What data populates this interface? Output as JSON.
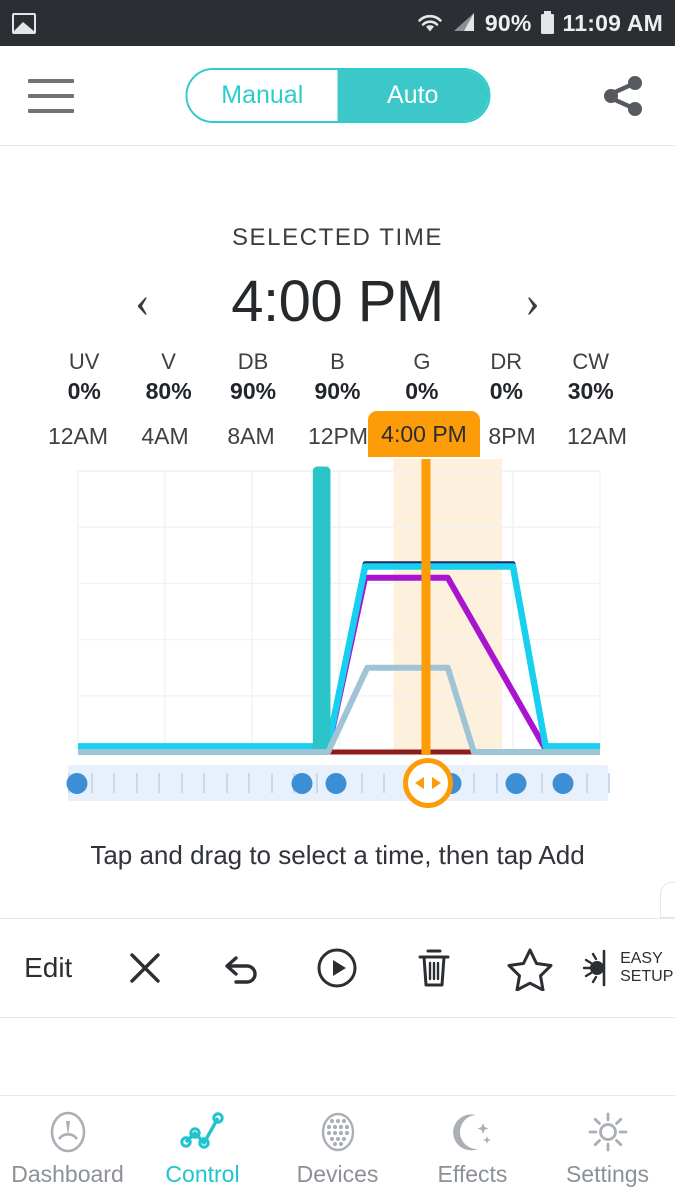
{
  "status_bar": {
    "left_icon": "image-icon",
    "wifi_icon": "wifi-icon",
    "signal_icon": "signal-icon",
    "battery_percent": "90%",
    "battery_icon": "battery-icon",
    "clock": "11:09 AM"
  },
  "toolbar": {
    "menu_icon": "hamburger-menu-icon",
    "mode_manual": "Manual",
    "mode_auto": "Auto",
    "active_mode": "Auto",
    "share_icon": "share-icon",
    "accent_color": "#3cc8c8"
  },
  "selected_time": {
    "label": "SELECTED TIME",
    "value": "4:00 PM",
    "prev_icon": "chevron-left-icon",
    "next_icon": "chevron-right-icon"
  },
  "channels": [
    {
      "name": "UV",
      "value": "0%"
    },
    {
      "name": "V",
      "value": "80%"
    },
    {
      "name": "DB",
      "value": "90%"
    },
    {
      "name": "B",
      "value": "90%"
    },
    {
      "name": "G",
      "value": "0%"
    },
    {
      "name": "DR",
      "value": "0%"
    },
    {
      "name": "CW",
      "value": "30%"
    }
  ],
  "axis": {
    "ticks": [
      "12AM",
      "4AM",
      "8AM",
      "12PM",
      "8PM",
      "12AM"
    ],
    "marker_label": "4:00 PM",
    "marker_color": "#FB9C08"
  },
  "hint": "Tap and drag to select a time, then tap Add",
  "action_bar": {
    "edit_label": "Edit",
    "close_icon": "close-icon",
    "undo_icon": "undo-icon",
    "play_icon": "play-circle-icon",
    "delete_icon": "trash-icon",
    "favorite_icon": "star-icon",
    "easy_setup_icon": "half-sun-icon",
    "easy_setup_line1": "EASY",
    "easy_setup_line2": "SETUP"
  },
  "bottom_nav": {
    "active": "Control",
    "items": [
      {
        "label": "Dashboard",
        "icon": "gauge-icon"
      },
      {
        "label": "Control",
        "icon": "line-chart-icon"
      },
      {
        "label": "Devices",
        "icon": "led-array-icon"
      },
      {
        "label": "Effects",
        "icon": "moon-stars-icon"
      },
      {
        "label": "Settings",
        "icon": "gear-icon"
      }
    ]
  },
  "chart_data": {
    "type": "line",
    "title": "",
    "xlabel": "",
    "ylabel": "",
    "x_ticks": [
      "12AM",
      "4AM",
      "8AM",
      "12PM",
      "4PM",
      "8PM",
      "12AM"
    ],
    "xlim": [
      0,
      24
    ],
    "ylim": [
      0,
      100
    ],
    "grid": true,
    "legend_position": "none",
    "selected_x": "4:00 PM",
    "selected_band": [
      14.5,
      19.5
    ],
    "series": [
      {
        "name": "UV",
        "color": "#8e1b1b",
        "x": [
          0,
          12.5,
          13.5,
          16.5,
          17.5,
          24
        ],
        "values": [
          0,
          0,
          0,
          0,
          0,
          0
        ]
      },
      {
        "name": "V",
        "color": "#A814D0",
        "x": [
          0,
          11.5,
          13.2,
          17.0,
          21.5,
          24
        ],
        "values": [
          1,
          1,
          62,
          62,
          1,
          1
        ]
      },
      {
        "name": "DB",
        "color": "#1d2b63",
        "x": [
          0,
          11.5,
          13.2,
          20.0,
          21.5,
          24
        ],
        "values": [
          1,
          1,
          67,
          67,
          1,
          1
        ]
      },
      {
        "name": "B",
        "color": "#17CFEE",
        "x": [
          0,
          11.5,
          13.2,
          20.0,
          21.5,
          24
        ],
        "values": [
          2,
          2,
          66,
          66,
          2,
          2
        ]
      },
      {
        "name": "G",
        "color": "#2BC4C9",
        "x": [
          11.0,
          11.0,
          11.4,
          11.4
        ],
        "values": [
          0,
          100,
          100,
          0
        ]
      },
      {
        "name": "CW",
        "color": "#9FC4D6",
        "x": [
          0,
          11.5,
          13.3,
          17.0,
          18.2,
          24
        ],
        "values": [
          0,
          0,
          30,
          30,
          0,
          0
        ]
      }
    ],
    "slider_points_hours": [
      0.4,
      10.4,
      11.9,
      15.4,
      17.0,
      19.9,
      22.0
    ],
    "handle_hour": 16.0
  }
}
